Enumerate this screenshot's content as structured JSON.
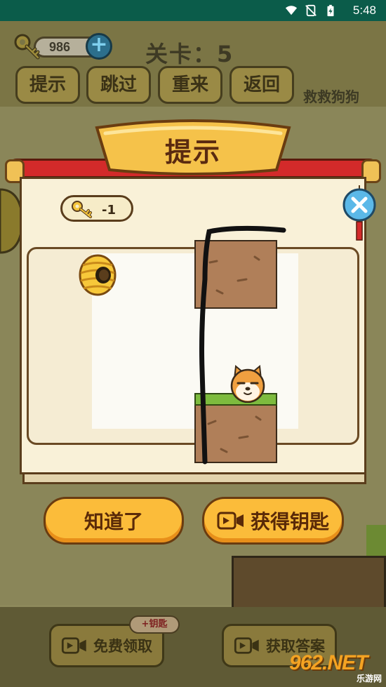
{
  "status_bar": {
    "time": "5:48"
  },
  "header": {
    "key_count": "986",
    "level_label": "关卡：5",
    "buttons": [
      "提示",
      "跳过",
      "重来",
      "返回"
    ],
    "game_name": "救救狗狗"
  },
  "bottom": {
    "free_claim_label": "免费领取",
    "bonus_badge": "+钥匙",
    "get_answer_label": "获取答案"
  },
  "modal": {
    "title": "提示",
    "key_cost": "-1",
    "got_it_label": "知道了",
    "get_key_label": "获得钥匙"
  },
  "watermark": {
    "logo": "962.NET",
    "sub": "乐游网"
  },
  "colors": {
    "status_bar": "#0b5c4a",
    "banner": "#f5c24a",
    "button": "#fbbc3a",
    "close_button": "#5bb8e8",
    "scroll_rod": "#d32a2a",
    "dirt": "#b07f59",
    "grass": "#7dbb3e"
  },
  "icons": [
    "key-icon",
    "plus-icon",
    "close-icon",
    "video-camera-icon",
    "beehive-icon",
    "shiba-dog-icon",
    "wifi-icon",
    "battery-icon"
  ]
}
